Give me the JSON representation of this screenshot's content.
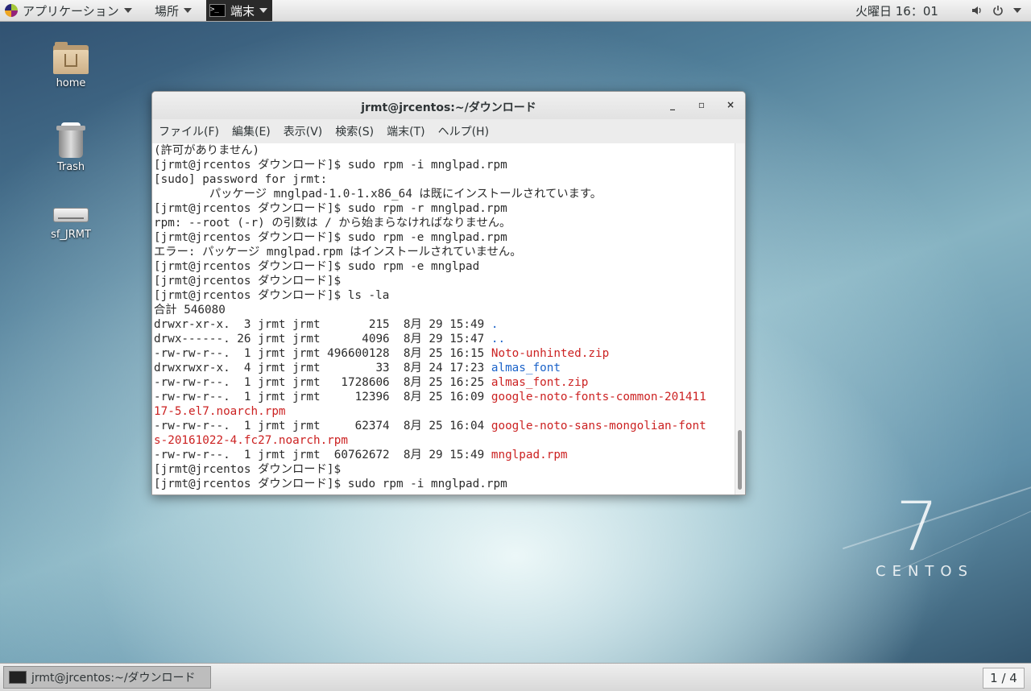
{
  "top_panel": {
    "applications": "アプリケーション",
    "places": "場所",
    "terminal_tab": "端末",
    "clock": "火曜日 16：01"
  },
  "desktop_icons": [
    {
      "label": "home",
      "icon": "home-folder-icon"
    },
    {
      "label": "Trash",
      "icon": "trash-icon"
    },
    {
      "label": "sf_JRMT",
      "icon": "drive-icon"
    }
  ],
  "window": {
    "title": "jrmt@jrcentos:~/ダウンロード",
    "menu": [
      "ファイル(F)",
      "編集(E)",
      "表示(V)",
      "検索(S)",
      "端末(T)",
      "ヘルプ(H)"
    ],
    "lines": [
      {
        "segs": [
          {
            "t": "(許可がありません)",
            "c": ""
          }
        ]
      },
      {
        "segs": [
          {
            "t": "[jrmt@jrcentos ダウンロード]$ sudo rpm -i mnglpad.rpm",
            "c": ""
          }
        ]
      },
      {
        "segs": [
          {
            "t": "[sudo] password for jrmt:",
            "c": ""
          }
        ]
      },
      {
        "segs": [
          {
            "t": "        パッケージ mnglpad-1.0-1.x86_64 は既にインストールされています。",
            "c": ""
          }
        ]
      },
      {
        "segs": [
          {
            "t": "[jrmt@jrcentos ダウンロード]$ sudo rpm -r mnglpad.rpm",
            "c": ""
          }
        ]
      },
      {
        "segs": [
          {
            "t": "rpm: --root (-r) の引数は / から始まらなければなりません。",
            "c": ""
          }
        ]
      },
      {
        "segs": [
          {
            "t": "[jrmt@jrcentos ダウンロード]$ sudo rpm -e mnglpad.rpm",
            "c": ""
          }
        ]
      },
      {
        "segs": [
          {
            "t": "エラー: パッケージ mnglpad.rpm はインストールされていません。",
            "c": ""
          }
        ]
      },
      {
        "segs": [
          {
            "t": "[jrmt@jrcentos ダウンロード]$ sudo rpm -e mnglpad",
            "c": ""
          }
        ]
      },
      {
        "segs": [
          {
            "t": "[jrmt@jrcentos ダウンロード]$",
            "c": ""
          }
        ]
      },
      {
        "segs": [
          {
            "t": "[jrmt@jrcentos ダウンロード]$ ls -la",
            "c": ""
          }
        ]
      },
      {
        "segs": [
          {
            "t": "合計 546080",
            "c": ""
          }
        ]
      },
      {
        "segs": [
          {
            "t": "drwxr-xr-x.  3 jrmt jrmt       215  8月 29 15:49 ",
            "c": ""
          },
          {
            "t": ".",
            "c": "c-blue"
          }
        ]
      },
      {
        "segs": [
          {
            "t": "drwx------. 26 jrmt jrmt      4096  8月 29 15:47 ",
            "c": ""
          },
          {
            "t": "..",
            "c": "c-blue"
          }
        ]
      },
      {
        "segs": [
          {
            "t": "-rw-rw-r--.  1 jrmt jrmt 496600128  8月 25 16:15 ",
            "c": ""
          },
          {
            "t": "Noto-unhinted.zip",
            "c": "c-red"
          }
        ]
      },
      {
        "segs": [
          {
            "t": "drwxrwxr-x.  4 jrmt jrmt        33  8月 24 17:23 ",
            "c": ""
          },
          {
            "t": "almas_font",
            "c": "c-blue"
          }
        ]
      },
      {
        "segs": [
          {
            "t": "-rw-rw-r--.  1 jrmt jrmt   1728606  8月 25 16:25 ",
            "c": ""
          },
          {
            "t": "almas_font.zip",
            "c": "c-red"
          }
        ]
      },
      {
        "segs": [
          {
            "t": "-rw-rw-r--.  1 jrmt jrmt     12396  8月 25 16:09 ",
            "c": ""
          },
          {
            "t": "google-noto-fonts-common-201411",
            "c": "c-red"
          }
        ]
      },
      {
        "segs": [
          {
            "t": "17-5.el7.noarch.rpm",
            "c": "c-red"
          }
        ]
      },
      {
        "segs": [
          {
            "t": "-rw-rw-r--.  1 jrmt jrmt     62374  8月 25 16:04 ",
            "c": ""
          },
          {
            "t": "google-noto-sans-mongolian-font",
            "c": "c-red"
          }
        ]
      },
      {
        "segs": [
          {
            "t": "s-20161022-4.fc27.noarch.rpm",
            "c": "c-red"
          }
        ]
      },
      {
        "segs": [
          {
            "t": "-rw-rw-r--.  1 jrmt jrmt  60762672  8月 29 15:49 ",
            "c": ""
          },
          {
            "t": "mnglpad.rpm",
            "c": "c-red"
          }
        ]
      },
      {
        "segs": [
          {
            "t": "[jrmt@jrcentos ダウンロード]$",
            "c": ""
          }
        ]
      },
      {
        "segs": [
          {
            "t": "[jrmt@jrcentos ダウンロード]$ sudo rpm -i mnglpad.rpm",
            "c": ""
          }
        ]
      }
    ],
    "colors": {
      "directory": "#1c63c9",
      "archive": "#cc2222"
    }
  },
  "branding": {
    "seven": "7",
    "word": "CENTOS"
  },
  "bottom_panel": {
    "task_label": "jrmt@jrcentos:~/ダウンロード",
    "workspace": "1 / 4"
  }
}
